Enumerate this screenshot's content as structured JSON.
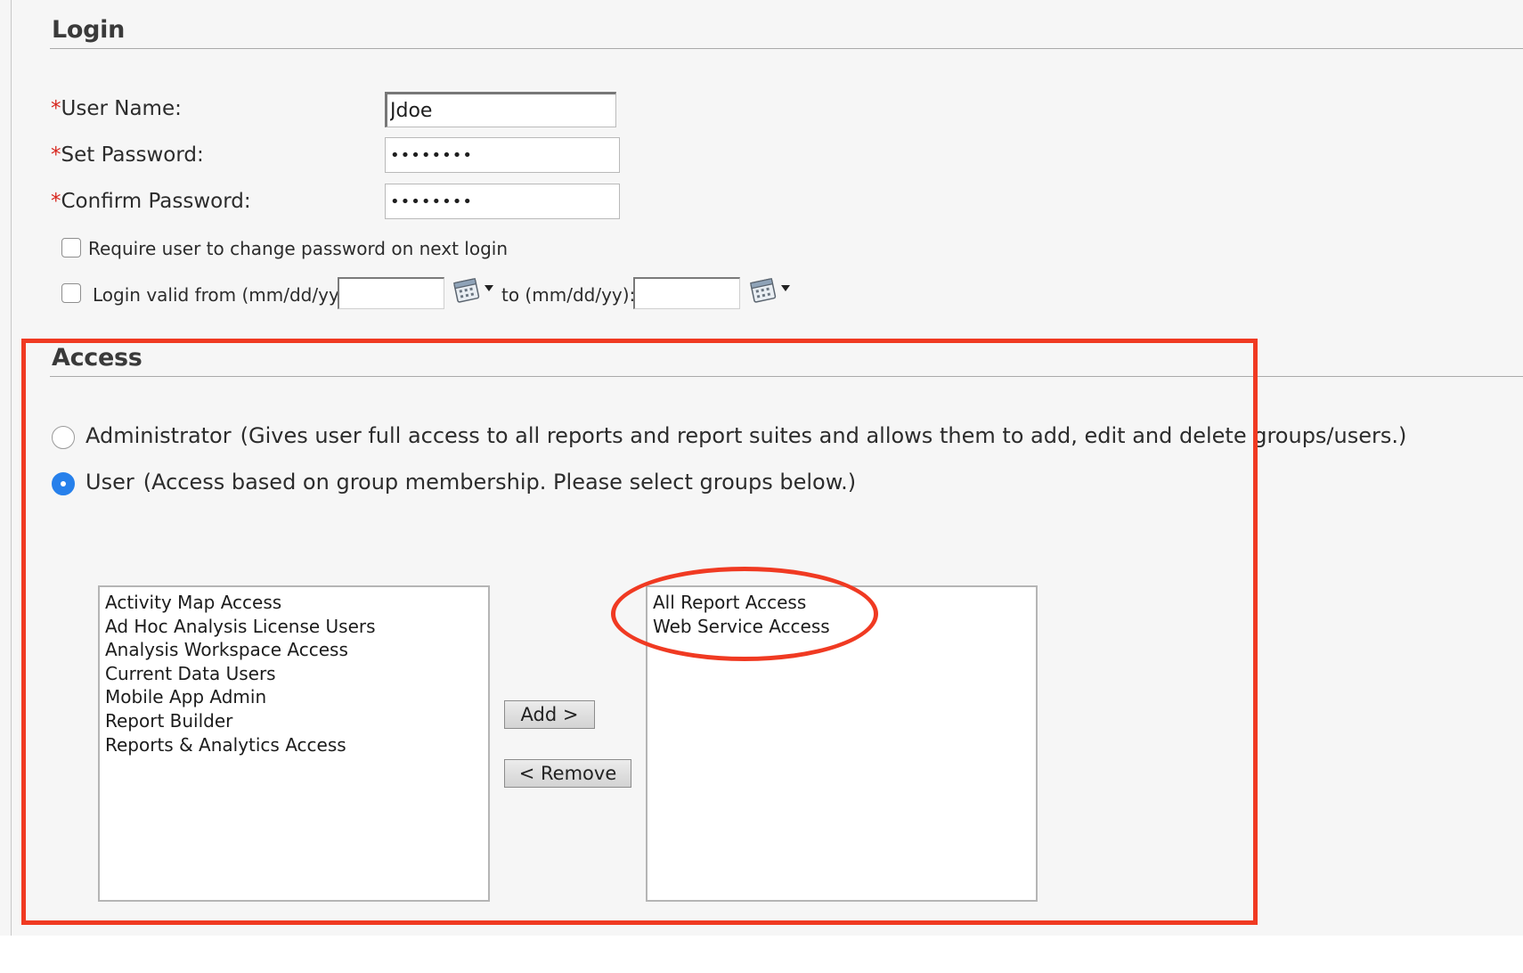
{
  "login": {
    "title": "Login",
    "required_mark": "*",
    "username_label": "User Name:",
    "username_value": "Jdoe",
    "set_password_label": "Set Password:",
    "set_password_value": "••••••••",
    "confirm_password_label": "Confirm Password:",
    "confirm_password_value": "••••••••",
    "require_change_label": "Require user to change password on next login",
    "valid_from_label": "Login valid from (mm/dd/yy):",
    "valid_to_label": "to (mm/dd/yy):",
    "valid_from_value": "",
    "valid_to_value": ""
  },
  "access": {
    "title": "Access",
    "admin_label": "Administrator",
    "admin_desc": "(Gives user full access to all reports and report suites and allows them to add, edit and delete groups/users.)",
    "user_label": "User",
    "user_desc": "(Access based on group membership. Please select groups below.)",
    "selected_role": "User",
    "available_groups": [
      "Activity Map Access",
      "Ad Hoc Analysis License Users",
      "Analysis Workspace Access",
      "Current Data Users",
      "Mobile App Admin",
      "Report Builder",
      "Reports & Analytics Access"
    ],
    "assigned_groups": [
      "All Report Access",
      "Web Service Access"
    ],
    "add_button": "Add >",
    "remove_button": "< Remove"
  },
  "annotation_color": "#f03a22",
  "accent_color": "#2680eb",
  "icons": {
    "calendar": "calendar-icon",
    "dropdown": "caret-down-icon"
  }
}
